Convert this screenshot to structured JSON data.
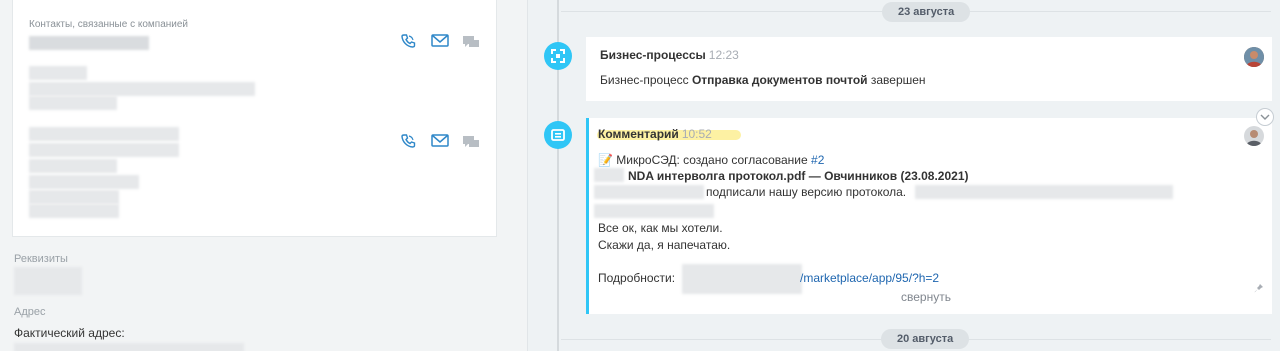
{
  "left": {
    "contacts_label": "Контакты, связанные с компанией",
    "requisites_label": "Реквизиты",
    "address_label": "Адрес",
    "actual_address_label": "Фактический адрес:"
  },
  "timeline": {
    "date_top": "23 августа",
    "date_bottom": "20 августа",
    "item1": {
      "title": "Бизнес-процессы",
      "time": "12:23",
      "text_prefix": "Бизнес-процесс ",
      "text_bold": "Отправка документов почтой",
      "text_suffix": " завершен"
    },
    "item2": {
      "title": "Комментарий",
      "time": "10:52",
      "line1_prefix": "📝 МикроСЭД: создано согласование ",
      "line1_link": "#2",
      "line2": "NDA интерволга протокол.pdf — Овчинников (23.08.2021)",
      "line3": "подписали нашу версию протокола.",
      "line4": "Все ок, как мы хотели.",
      "line5": "Скажи да, я напечатаю.",
      "details_label": "Подробности:",
      "details_link": "/marketplace/app/95/?h=2",
      "collapse": "свернуть"
    }
  },
  "colors": {
    "accent": "#2fc6f6",
    "highlight": "#fdf1a3",
    "link": "#2067b0"
  }
}
